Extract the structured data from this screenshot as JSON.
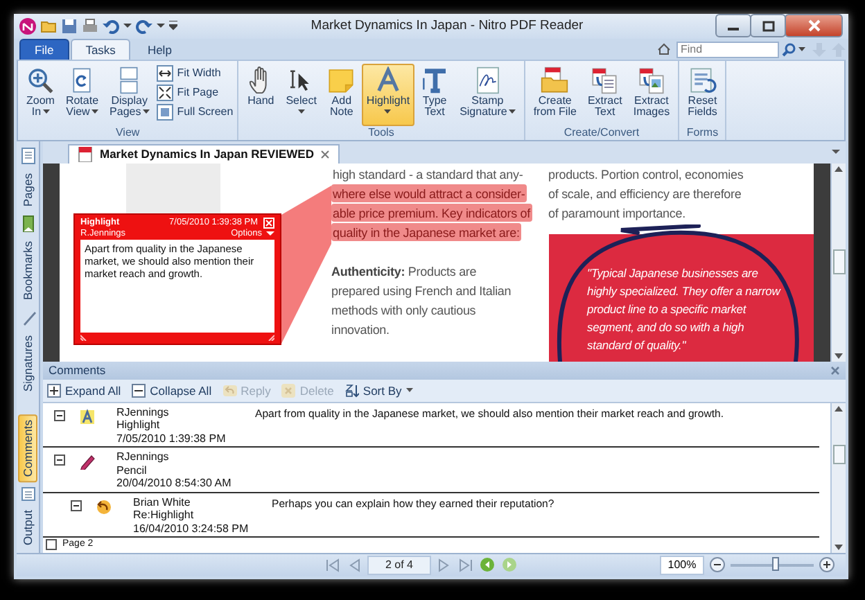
{
  "window": {
    "title": "Market Dynamics In Japan - Nitro PDF Reader"
  },
  "ribbon_tabs": [
    {
      "label": "File",
      "selected": false,
      "kind": "file"
    },
    {
      "label": "Tasks",
      "selected": true,
      "kind": "tab"
    },
    {
      "label": "Help",
      "selected": false,
      "kind": "tab"
    }
  ],
  "search": {
    "placeholder": "Find"
  },
  "ribbon_groups": [
    {
      "label": "View",
      "tools": [
        {
          "label": "Zoom In",
          "kind": "large",
          "dropdown": true,
          "selected": false
        },
        {
          "label": "Rotate View",
          "kind": "large",
          "dropdown": true,
          "selected": false
        },
        {
          "label": "Display Pages",
          "kind": "large",
          "dropdown": true,
          "selected": false
        },
        {
          "label": "Fit Width",
          "kind": "small",
          "selected": false
        },
        {
          "label": "Fit Page",
          "kind": "small",
          "selected": false
        },
        {
          "label": "Full Screen",
          "kind": "small",
          "selected": false
        }
      ]
    },
    {
      "label": "Tools",
      "tools": [
        {
          "label": "Hand",
          "kind": "large",
          "dropdown": false,
          "selected": false
        },
        {
          "label": "Select",
          "kind": "large",
          "dropdown": true,
          "selected": false
        },
        {
          "label": "Add Note",
          "kind": "large",
          "dropdown": false,
          "selected": false
        },
        {
          "label": "Highlight",
          "kind": "large",
          "dropdown": true,
          "selected": true
        },
        {
          "label": "Type Text",
          "kind": "large",
          "dropdown": false,
          "selected": false
        },
        {
          "label": "Stamp Signature",
          "kind": "large",
          "dropdown": true,
          "selected": false
        }
      ]
    },
    {
      "label": "Create/Convert",
      "tools": [
        {
          "label": "Create from File",
          "kind": "large",
          "dropdown": false,
          "selected": false
        },
        {
          "label": "Extract Text",
          "kind": "large",
          "dropdown": false,
          "selected": false
        },
        {
          "label": "Extract Images",
          "kind": "large",
          "dropdown": false,
          "selected": false
        }
      ]
    },
    {
      "label": "Forms",
      "tools": [
        {
          "label": "Reset Fields",
          "kind": "large",
          "dropdown": false,
          "selected": false
        }
      ]
    }
  ],
  "side_tabs": [
    {
      "label": "Pages",
      "selected": false
    },
    {
      "label": "Bookmarks",
      "selected": false
    },
    {
      "label": "Signatures",
      "selected": false
    }
  ],
  "document_tab": {
    "label": "Market Dynamics In Japan REVIEWED"
  },
  "page": {
    "left_lines": [
      {
        "text": "high standard - a standard that any-",
        "highlighted": false
      },
      {
        "text": "where else would attract a consider-",
        "highlighted": true
      },
      {
        "text": "able price premium. Key indicators of",
        "highlighted": true
      },
      {
        "text": "quality in the  Japanese market are:",
        "highlighted": true
      }
    ],
    "paragraph": "**Authenticity:** Products are prepared using French and Italian methods with only cautious innovation.",
    "right_lines": [
      "products. Portion control, economies",
      "of scale, and efficiency are therefore",
      "of paramount importance."
    ],
    "quote": "\"Typical Japanese businesses are highly specialized. They offer a narrow product line to a specific market segment, and do so with a high standard of quality.\""
  },
  "popup": {
    "title": "Highlight",
    "date": "7/05/2010 1:39:38 PM",
    "author": "R.Jennings",
    "options": "Options",
    "text": "Apart from quality in the Japanese market, we should also mention their market reach and growth."
  },
  "comments_panel": {
    "title": "Comments",
    "toolbar": [
      {
        "label": "Expand All",
        "disabled": false
      },
      {
        "label": "Collapse All",
        "disabled": false
      },
      {
        "label": "Reply",
        "disabled": true
      },
      {
        "label": "Delete",
        "disabled": true
      },
      {
        "label": "Sort By",
        "disabled": false
      }
    ],
    "items": [
      {
        "kind": "highlight",
        "author": "RJennings",
        "type": "Highlight",
        "date": "7/05/2010 1:39:38 PM",
        "text": "Apart from quality in the Japanese market, we should also mention their market reach and growth.",
        "expanded": true
      },
      {
        "kind": "pencil",
        "author": "RJennings",
        "type": "Pencil",
        "date": "20/04/2010 8:54:30 AM",
        "expanded": true,
        "children": [
          {
            "kind": "reply",
            "author": "Brian White",
            "type": "Re:Highlight",
            "date": "16/04/2010 3:24:58 PM",
            "text": "Perhaps you can explain how they earned their reputation?",
            "expanded": true
          }
        ]
      }
    ],
    "page_row": {
      "label": "Page 2",
      "expanded": false
    }
  },
  "bottom_tabs": [
    {
      "label": "Comments",
      "selected": true
    },
    {
      "label": "Output",
      "selected": false
    }
  ],
  "status_bar": {
    "page": "2 of 4",
    "zoom": "100%",
    "zoom_slider": {
      "level": 0.55
    }
  }
}
